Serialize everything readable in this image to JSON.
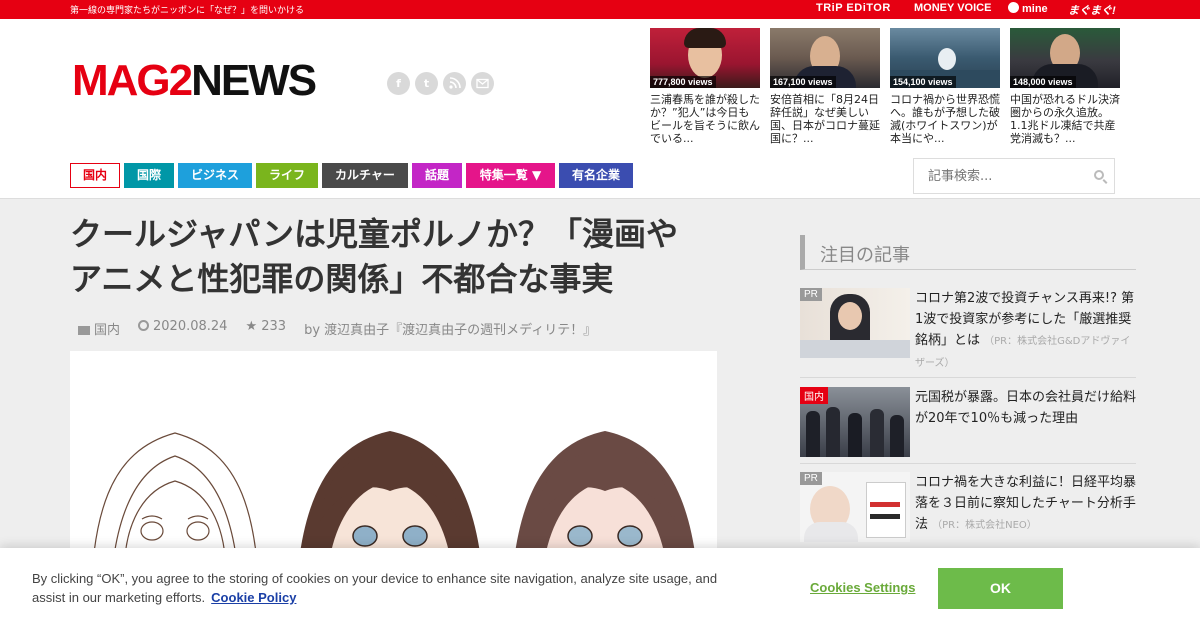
{
  "topbar": {
    "tagline": "第一線の専門家たちがニッポンに「なぜ？」を問いかける",
    "partners": [
      "TRiP EDiTOR",
      "MONEY VOICE",
      "mine",
      "まぐまぐ!"
    ]
  },
  "logo": {
    "part1": "MAG2",
    "part2": "NEWS"
  },
  "social": [
    "f",
    "t",
    "rss",
    "mail"
  ],
  "trending": [
    {
      "views": "777,800 views",
      "title": "三浦春馬を誰が殺したか？”犯人”は今日もビールを旨そうに飲んでいる..."
    },
    {
      "views": "167,100 views",
      "title": "安倍首相に「8月24日辞任説」なぜ美しい国、日本がコロナ蔓延国に？..."
    },
    {
      "views": "154,100 views",
      "title": "コロナ禍から世界恐慌へ。誰もが予想した破滅(ホワイトスワン)が本当にや..."
    },
    {
      "views": "148,000 views",
      "title": "中国が恐れるドル決済圏からの永久追放。1.1兆ドル凍結で共産党消滅も？..."
    }
  ],
  "nav": [
    "国内",
    "国際",
    "ビジネス",
    "ライフ",
    "カルチャー",
    "話題",
    "特集一覧 ▼",
    "有名企業"
  ],
  "search": {
    "placeholder": "記事検索..."
  },
  "article": {
    "headline": "クールジャパンは児童ポルノか？「漫画やアニメと性犯罪の関係」不都合な事実",
    "category": "国内",
    "date": "2020.08.24",
    "stars": "★ 233",
    "author": "by 渡辺真由子『渡辺真由子の週刊メディリテ！』"
  },
  "sidebar": {
    "heading": "注目の記事",
    "items": [
      {
        "tag": "PR",
        "title": "コロナ第2波で投資チャンス再来!? 第1波で投資家が参考にした「厳選推奨銘柄」とは",
        "sponsor": "（PR：株式会社G&Dアドヴァイザーズ）"
      },
      {
        "tag": "国内",
        "title": "元国税が暴露。日本の会社員だけ給料が20年で10％も減った理由",
        "sponsor": ""
      },
      {
        "tag": "PR",
        "title": "コロナ禍を大きな利益に！日経平均暴落を３日前に察知したチャート分析手法",
        "sponsor": "（PR：株式会社NEO）"
      }
    ]
  },
  "cookie": {
    "message": "By clicking “OK”, you agree to the storing of cookies on your device to enhance site navigation, analyze site usage, and assist in our marketing efforts.",
    "policy_link": "Cookie Policy",
    "settings": "Cookies Settings",
    "ok": "OK"
  },
  "colors": {
    "brand_red": "#e60012",
    "ok_green": "#6dbb4a"
  }
}
